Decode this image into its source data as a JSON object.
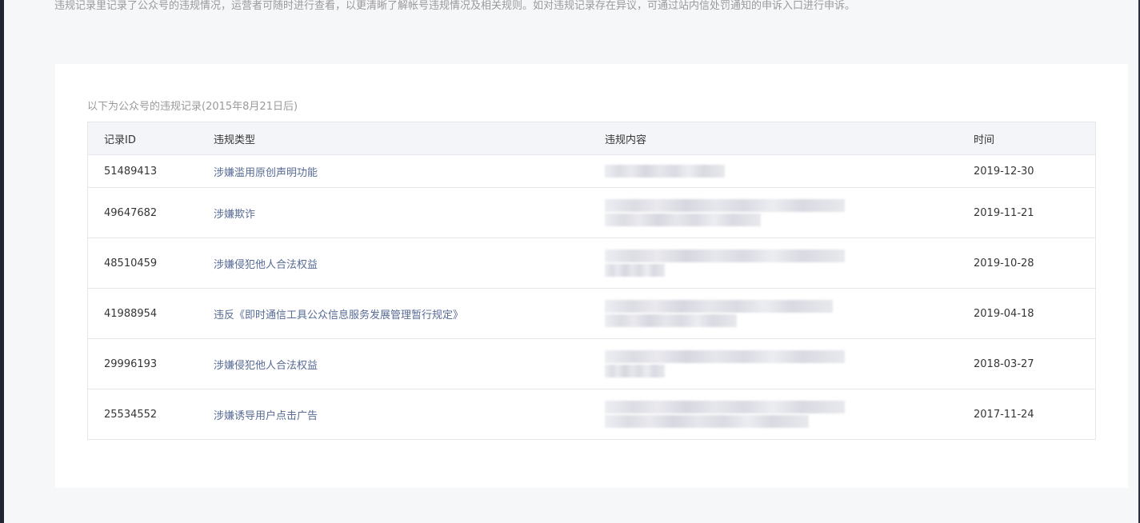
{
  "description": "违规记录里记录了公众号的违规情况，运营者可随时进行查看，以更清晰了解帐号违规情况及相关规则。如对违规记录存在异议，可通过站内信处罚通知的申诉入口进行申诉。",
  "caption": "以下为公众号的违规记录(2015年8月21日后)",
  "table": {
    "headers": {
      "id": "记录ID",
      "type": "违规类型",
      "content": "违规内容",
      "time": "时间"
    },
    "rows": [
      {
        "id": "51489413",
        "type": "涉嫌滥用原创声明功能",
        "time": "2019-12-30",
        "content_lines": 1
      },
      {
        "id": "49647682",
        "type": "涉嫌欺诈",
        "time": "2019-11-21",
        "content_lines": 2
      },
      {
        "id": "48510459",
        "type": "涉嫌侵犯他人合法权益",
        "time": "2019-10-28",
        "content_lines": 2
      },
      {
        "id": "41988954",
        "type": "违反《即时通信工具公众信息服务发展管理暂行规定》",
        "time": "2019-04-18",
        "content_lines": 2
      },
      {
        "id": "29996193",
        "type": "涉嫌侵犯他人合法权益",
        "time": "2018-03-27",
        "content_lines": 2
      },
      {
        "id": "25534552",
        "type": "涉嫌诱导用户点击广告",
        "time": "2017-11-24",
        "content_lines": 2
      }
    ]
  }
}
